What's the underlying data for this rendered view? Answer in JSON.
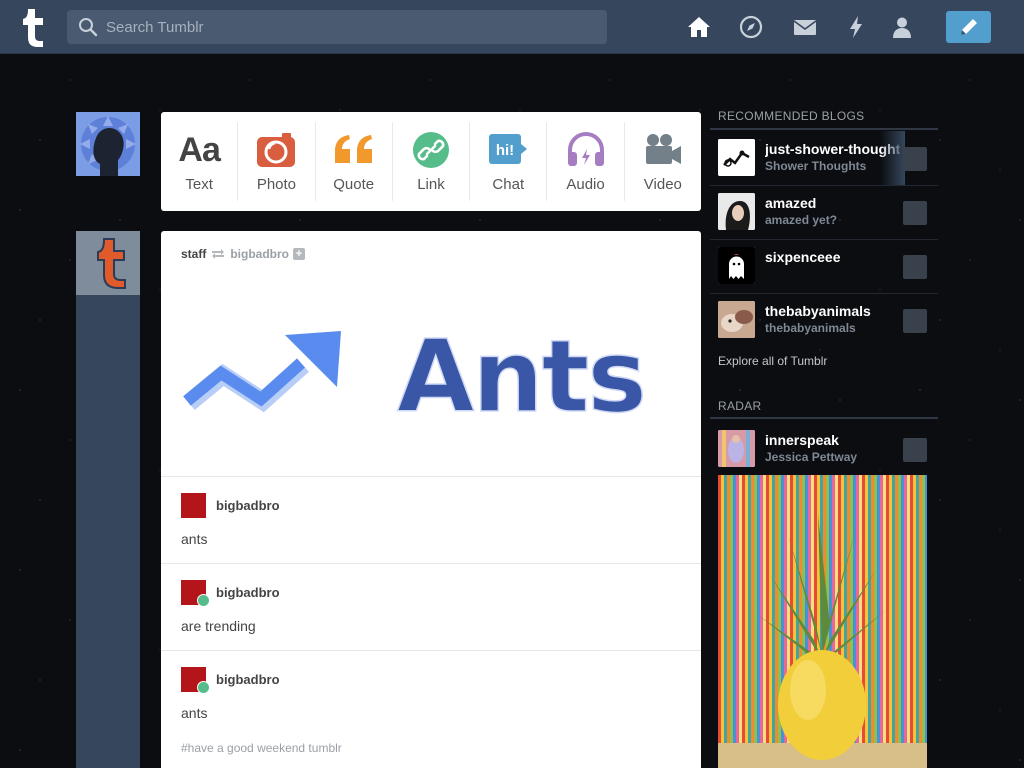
{
  "header": {
    "search_placeholder": "Search Tumblr",
    "nav": [
      "home-icon",
      "explore-icon",
      "inbox-icon",
      "activity-icon",
      "account-icon"
    ],
    "compose_icon": "pencil-icon",
    "colors": {
      "bar": "#36465d",
      "compose": "#529ecc"
    }
  },
  "composer": {
    "types": [
      {
        "label": "Text",
        "icon": "text-icon",
        "color": "#444444"
      },
      {
        "label": "Photo",
        "icon": "camera-icon",
        "color": "#d95e40"
      },
      {
        "label": "Quote",
        "icon": "quote-icon",
        "color": "#f2992e"
      },
      {
        "label": "Link",
        "icon": "link-icon",
        "color": "#56bc8a"
      },
      {
        "label": "Chat",
        "icon": "chat-icon",
        "color": "#529ecc"
      },
      {
        "label": "Audio",
        "icon": "headphones-icon",
        "color": "#a77dc2"
      },
      {
        "label": "Video",
        "icon": "video-camera-icon",
        "color": "#748089"
      }
    ]
  },
  "post": {
    "poster": "staff",
    "reblogged_from": "bigbadbro",
    "plus": "+",
    "image_text": "Ants",
    "reblogs": [
      {
        "name": "bigbadbro",
        "body": "ants",
        "reblog": false
      },
      {
        "name": "bigbadbro",
        "body": "are trending",
        "reblog": true
      },
      {
        "name": "bigbadbro",
        "body": "ants",
        "reblog": true
      }
    ],
    "tags": "#have a good weekend tumblr"
  },
  "sidebar": {
    "recommended_title": "RECOMMENDED BLOGS",
    "blogs": [
      {
        "name": "just-shower-thoughts",
        "desc": "Shower Thoughts"
      },
      {
        "name": "amazed",
        "desc": "amazed yet?"
      },
      {
        "name": "sixpenceee",
        "desc": ""
      },
      {
        "name": "thebabyanimals",
        "desc": "thebabyanimals"
      }
    ],
    "explore": "Explore all of Tumblr",
    "radar_title": "RADAR",
    "radar": {
      "name": "innerspeak",
      "desc": "Jessica Pettway"
    }
  }
}
